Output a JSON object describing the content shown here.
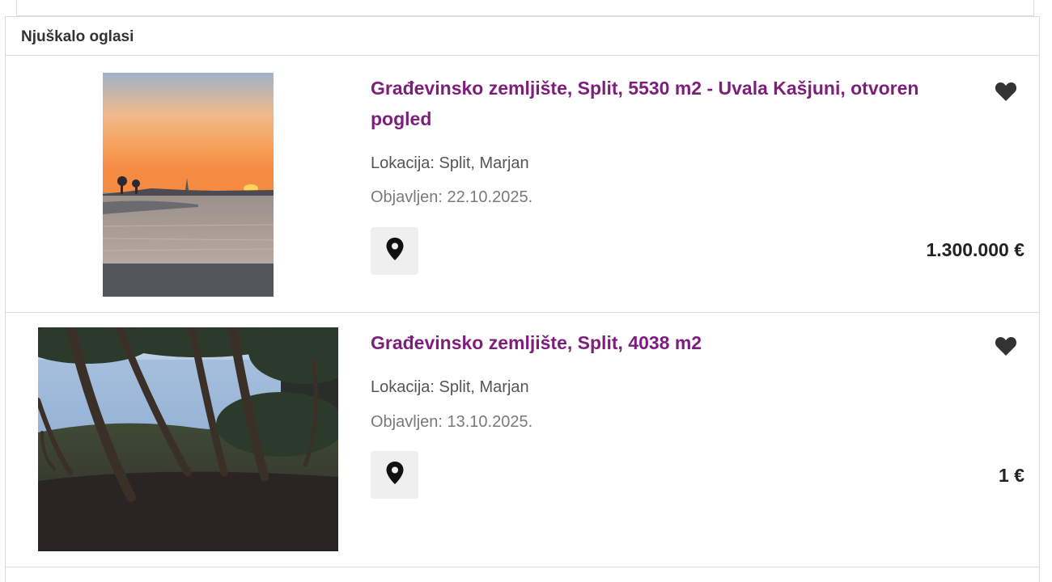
{
  "section": {
    "title": "Njuškalo oglasi"
  },
  "listings": [
    {
      "title": "Građevinsko zemljište, Split, 5530 m2 - Uvala Kašjuni, otvoren pogled",
      "location": "Lokacija: Split, Marjan",
      "published": "Objavljen: 22.10.2025.",
      "price": "1.300.000 €",
      "image": "sunset-sea-photo",
      "map_icon": "map-pin-icon",
      "favorite_icon": "heart-icon"
    },
    {
      "title": "Građevinsko zemljište, Split, 4038 m2",
      "location": "Lokacija: Split, Marjan",
      "published": "Objavljen: 13.10.2025.",
      "price": "1 €",
      "image": "pine-forest-coast-photo",
      "map_icon": "map-pin-icon",
      "favorite_icon": "heart-icon"
    }
  ],
  "colors": {
    "title": "#7d1e7c",
    "border": "#dcdcdc",
    "button_bg": "#efefef"
  }
}
